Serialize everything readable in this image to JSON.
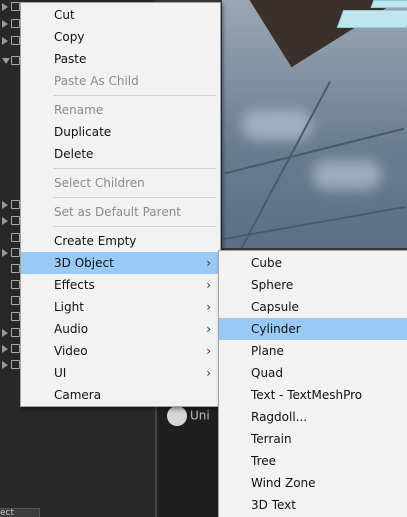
{
  "context_menu": {
    "items": [
      {
        "label": "Cut",
        "disabled": false
      },
      {
        "label": "Copy",
        "disabled": false
      },
      {
        "label": "Paste",
        "disabled": false
      },
      {
        "label": "Paste As Child",
        "disabled": true
      },
      {
        "label": "Rename",
        "disabled": true
      },
      {
        "label": "Duplicate",
        "disabled": false
      },
      {
        "label": "Delete",
        "disabled": false
      },
      {
        "label": "Select Children",
        "disabled": true
      },
      {
        "label": "Set as Default Parent",
        "disabled": true
      },
      {
        "label": "Create Empty",
        "disabled": false
      },
      {
        "label": "3D Object",
        "has_submenu": true,
        "highlighted": true
      },
      {
        "label": "Effects",
        "has_submenu": true
      },
      {
        "label": "Light",
        "has_submenu": true
      },
      {
        "label": "Audio",
        "has_submenu": true
      },
      {
        "label": "Video",
        "has_submenu": true
      },
      {
        "label": "UI",
        "has_submenu": true
      },
      {
        "label": "Camera",
        "has_submenu": false
      }
    ],
    "submenu_arrow": "›"
  },
  "submenu_3d_object": {
    "items": [
      {
        "label": "Cube"
      },
      {
        "label": "Sphere"
      },
      {
        "label": "Capsule"
      },
      {
        "label": "Cylinder",
        "highlighted": true
      },
      {
        "label": "Plane"
      },
      {
        "label": "Quad"
      },
      {
        "label": "Text - TextMeshPro"
      },
      {
        "label": "Ragdoll..."
      },
      {
        "label": "Terrain"
      },
      {
        "label": "Tree"
      },
      {
        "label": "Wind Zone"
      },
      {
        "label": "3D Text"
      }
    ]
  },
  "background": {
    "unity_label": "Uni",
    "bottom_tab_label": "ect"
  },
  "colors": {
    "menu_bg": "#f2f2f2",
    "highlight": "#99c9f5",
    "disabled_text": "#8b8b8b",
    "editor_dark": "#282828"
  }
}
